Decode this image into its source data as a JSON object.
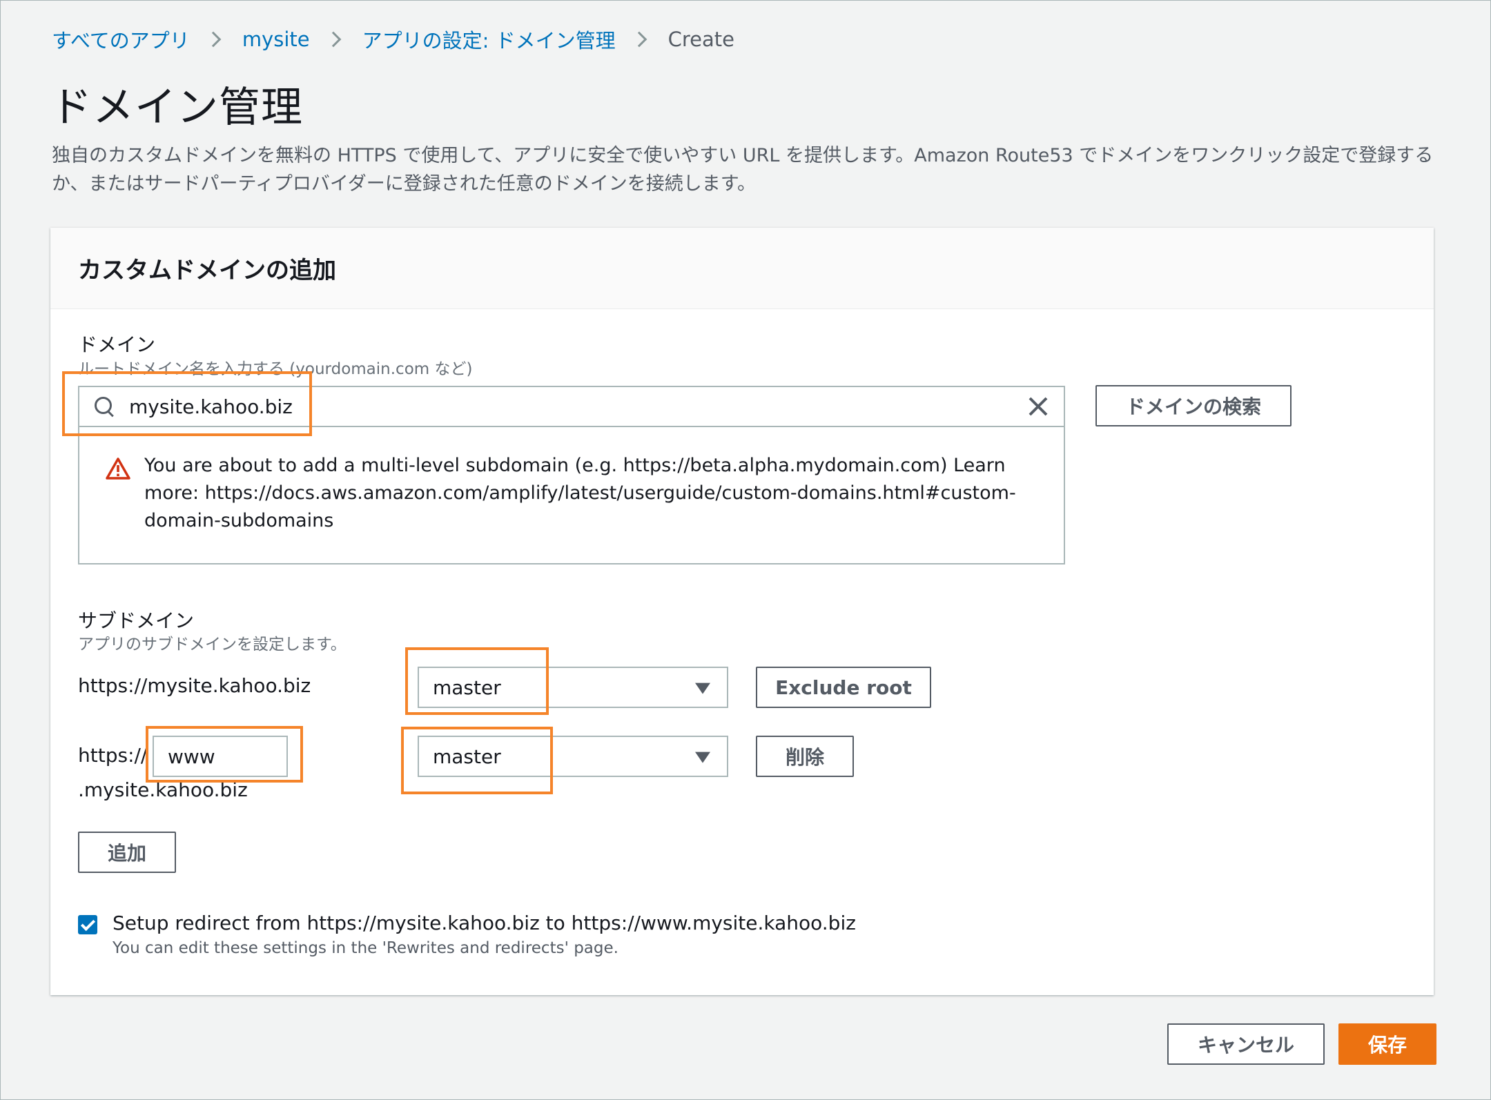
{
  "breadcrumb": {
    "items": [
      "すべてのアプリ",
      "mysite",
      "アプリの設定: ドメイン管理"
    ],
    "current": "Create"
  },
  "page": {
    "title": "ドメイン管理",
    "description": "独自のカスタムドメインを無料の HTTPS で使用して、アプリに安全で使いやすい URL を提供します。Amazon Route53 でドメインをワンクリック設定で登録するか、またはサードパーティプロバイダーに登録された任意のドメインを接続します。"
  },
  "panel": {
    "title": "カスタムドメインの追加"
  },
  "domain": {
    "label": "ドメイン",
    "hint": "ルートドメイン名を入力する (yourdomain.com など)",
    "value": "mysite.kahoo.biz",
    "search_button": "ドメインの検索",
    "alert": "You are about to add a multi-level subdomain (e.g. https://beta.alpha.mydomain.com) Learn more: https://docs.aws.amazon.com/amplify/latest/userguide/custom-domains.html#custom-domain-subdomains"
  },
  "subdomain": {
    "label": "サブドメイン",
    "hint": "アプリのサブドメインを設定します。",
    "rows": [
      {
        "url": "https://mysite.kahoo.biz",
        "branch": "master",
        "action": "Exclude root"
      },
      {
        "prefix": "https://",
        "value": "www",
        "suffix": ".mysite.kahoo.biz",
        "branch": "master",
        "action": "削除"
      }
    ],
    "add_button": "追加"
  },
  "redirect": {
    "checked": true,
    "label": "Setup redirect from https://mysite.kahoo.biz to https://www.mysite.kahoo.biz",
    "hint": "You can edit these settings in the 'Rewrites and redirects' page."
  },
  "footer": {
    "cancel": "キャンセル",
    "save": "保存"
  },
  "colors": {
    "link": "#0073bb",
    "primary": "#ec7211",
    "highlight": "#f5842a",
    "warning": "#d13212"
  }
}
